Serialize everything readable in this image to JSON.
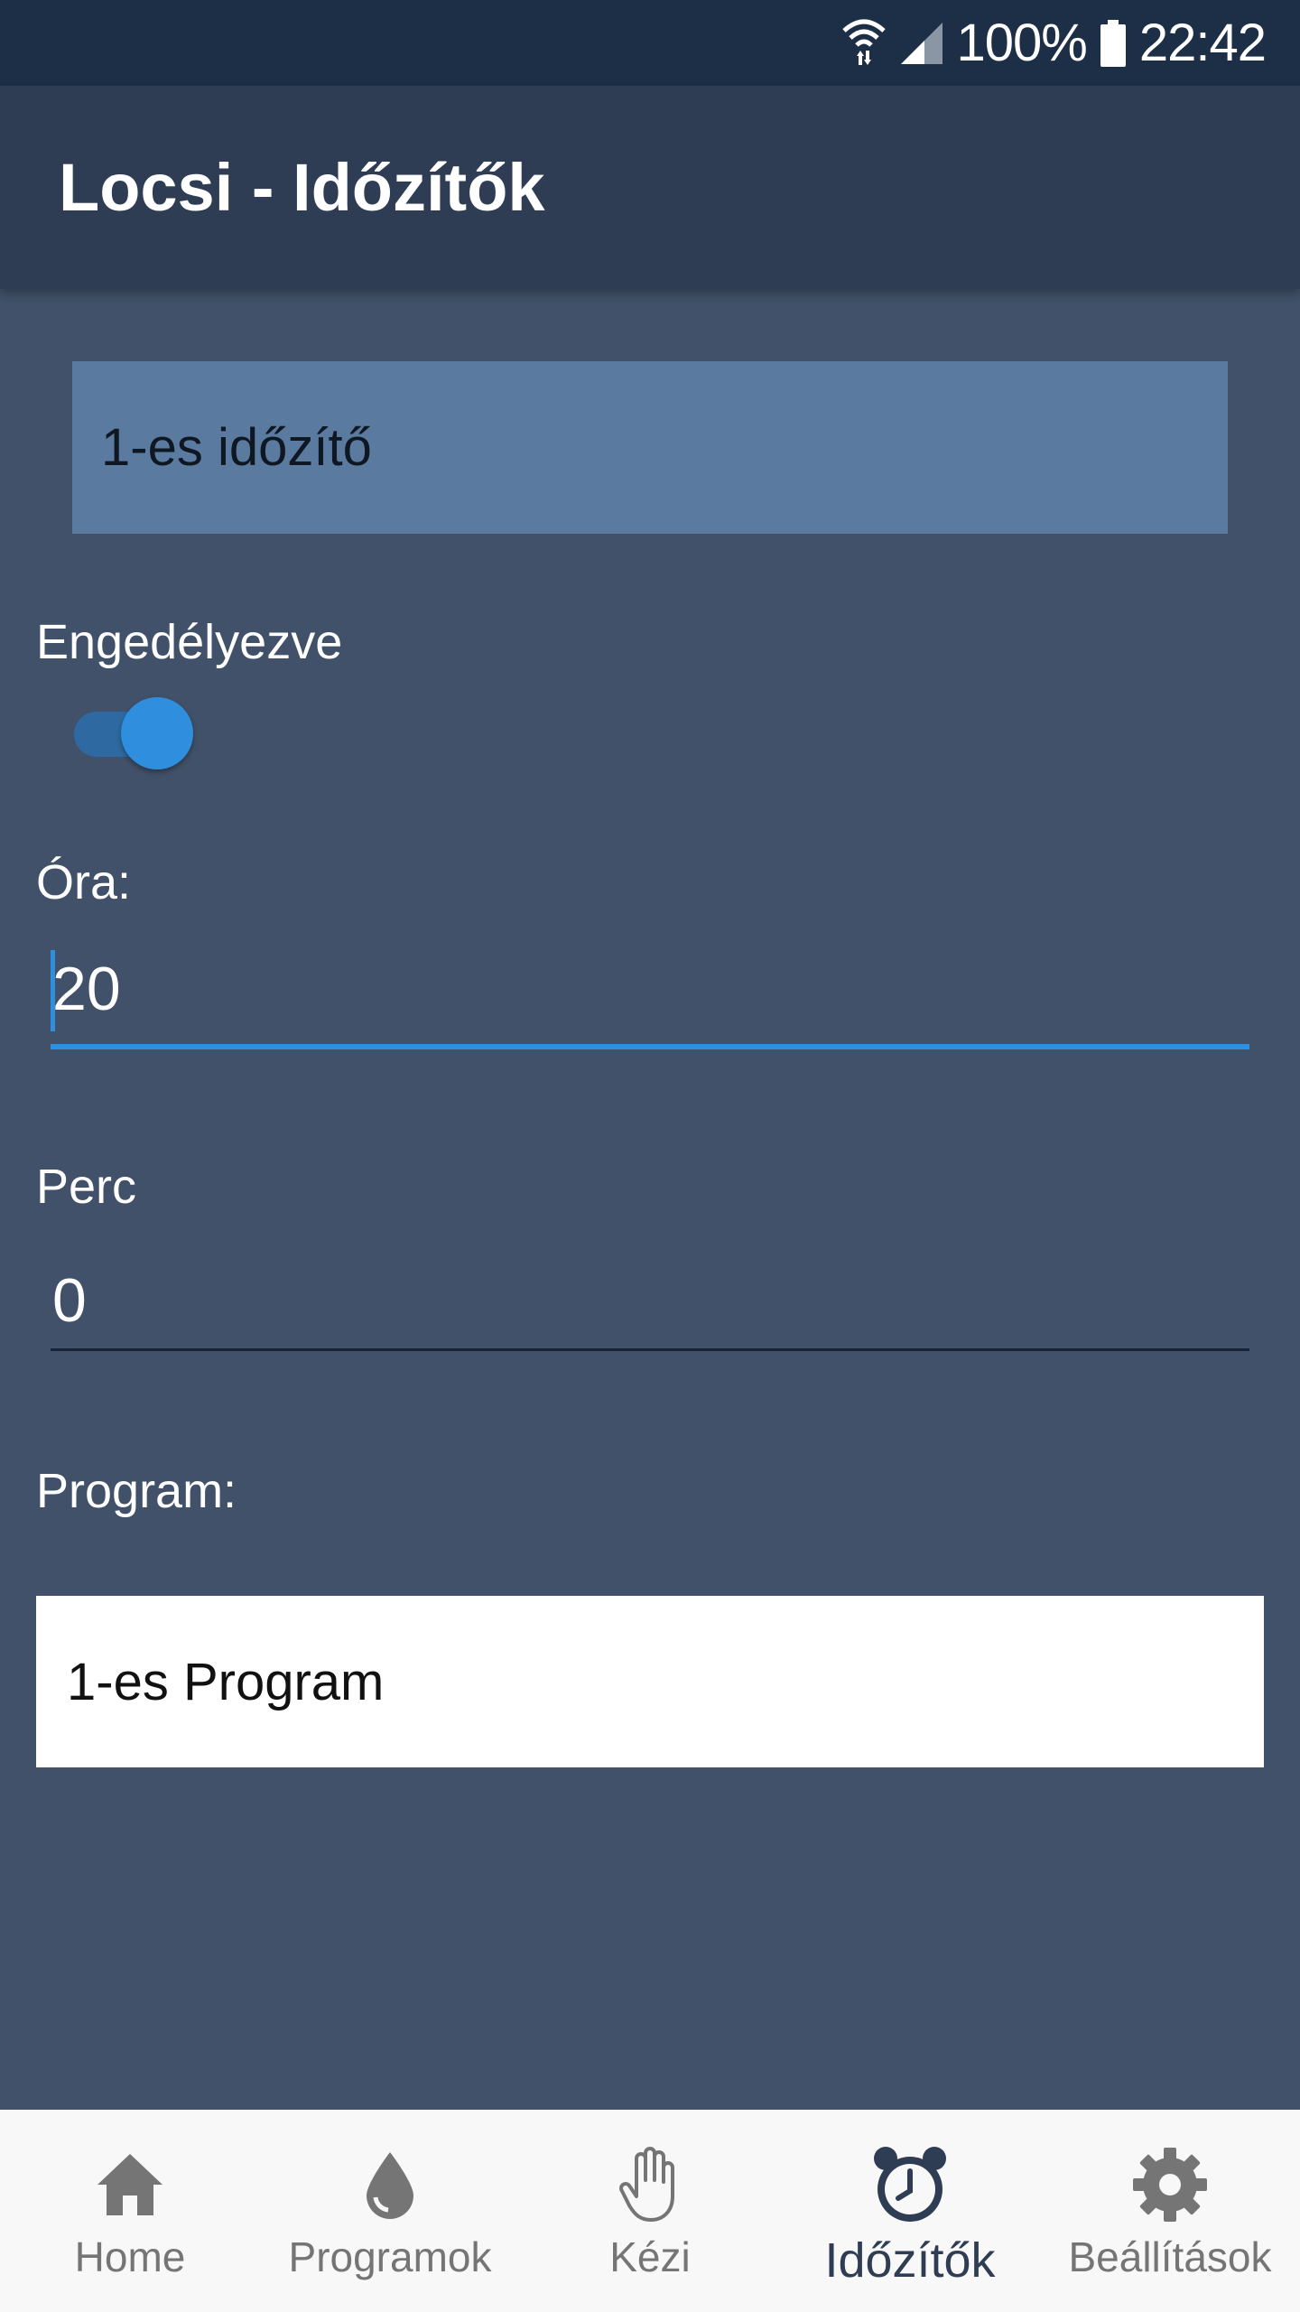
{
  "status_bar": {
    "battery": "100%",
    "time": "22:42"
  },
  "app_bar": {
    "title": "Locsi - Időzítők"
  },
  "timer": {
    "name": "1-es időzítő",
    "enabled_label": "Engedélyezve",
    "enabled": true,
    "hour_label": "Óra:",
    "hour_value": "20",
    "minute_label": "Perc",
    "minute_value": "0",
    "program_label": "Program:",
    "program_value": "1-es Program"
  },
  "colors": {
    "background": "#415169",
    "app_bar": "#2e3d53",
    "status_bar": "#1d2f47",
    "accent": "#2f8fde"
  },
  "bottom_nav": {
    "items": [
      {
        "label": "Home",
        "icon": "home-icon",
        "active": false
      },
      {
        "label": "Programok",
        "icon": "water-drop-icon",
        "active": false
      },
      {
        "label": "Kézi",
        "icon": "hand-icon",
        "active": false
      },
      {
        "label": "Időzítők",
        "icon": "alarm-clock-icon",
        "active": true
      },
      {
        "label": "Beállítások",
        "icon": "gear-icon",
        "active": false
      }
    ]
  }
}
